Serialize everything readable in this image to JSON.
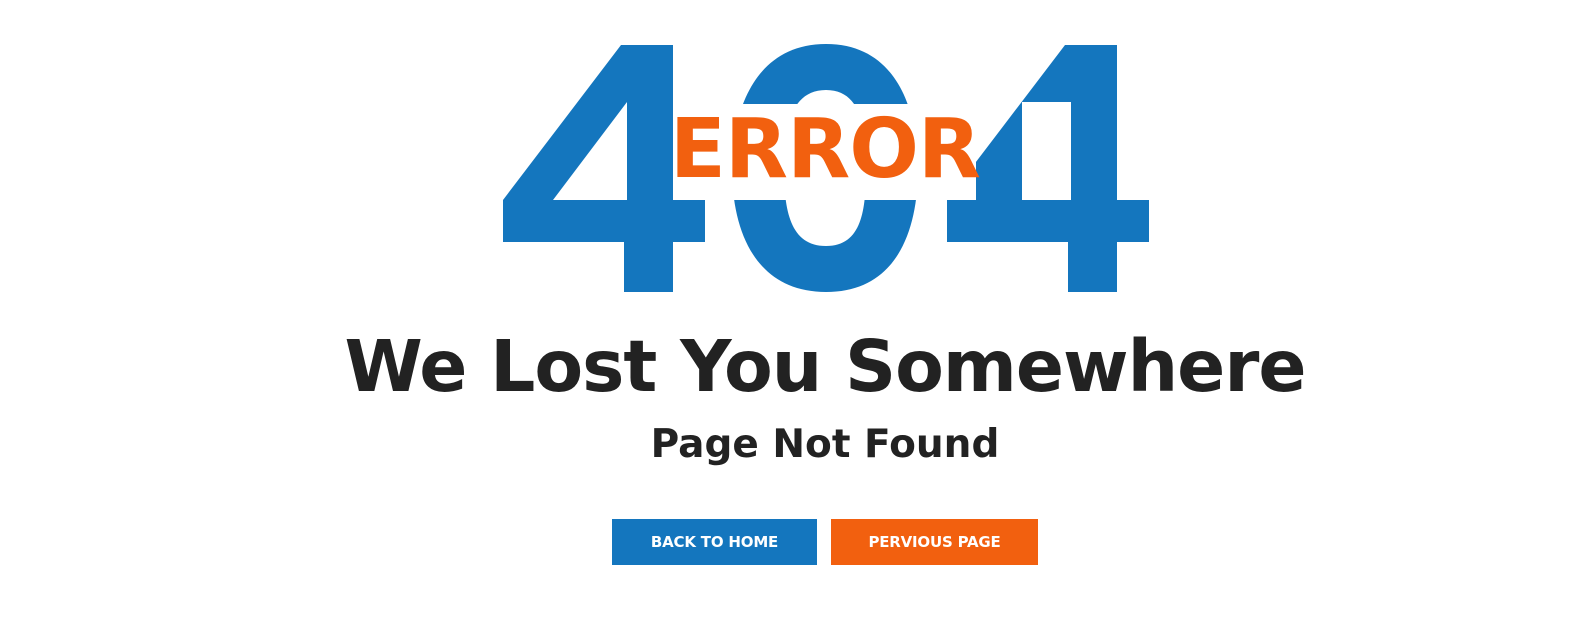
{
  "hero": {
    "big_number": "404",
    "overlay_word": "ERROR"
  },
  "headline": "We Lost You Somewhere",
  "subheadline": "Page Not Found",
  "buttons": {
    "home_label": "BACK TO HOME",
    "previous_label": "PERVIOUS PAGE"
  },
  "colors": {
    "primary": "#1476be",
    "accent": "#f2600f",
    "text": "#222222",
    "background": "#ffffff"
  }
}
